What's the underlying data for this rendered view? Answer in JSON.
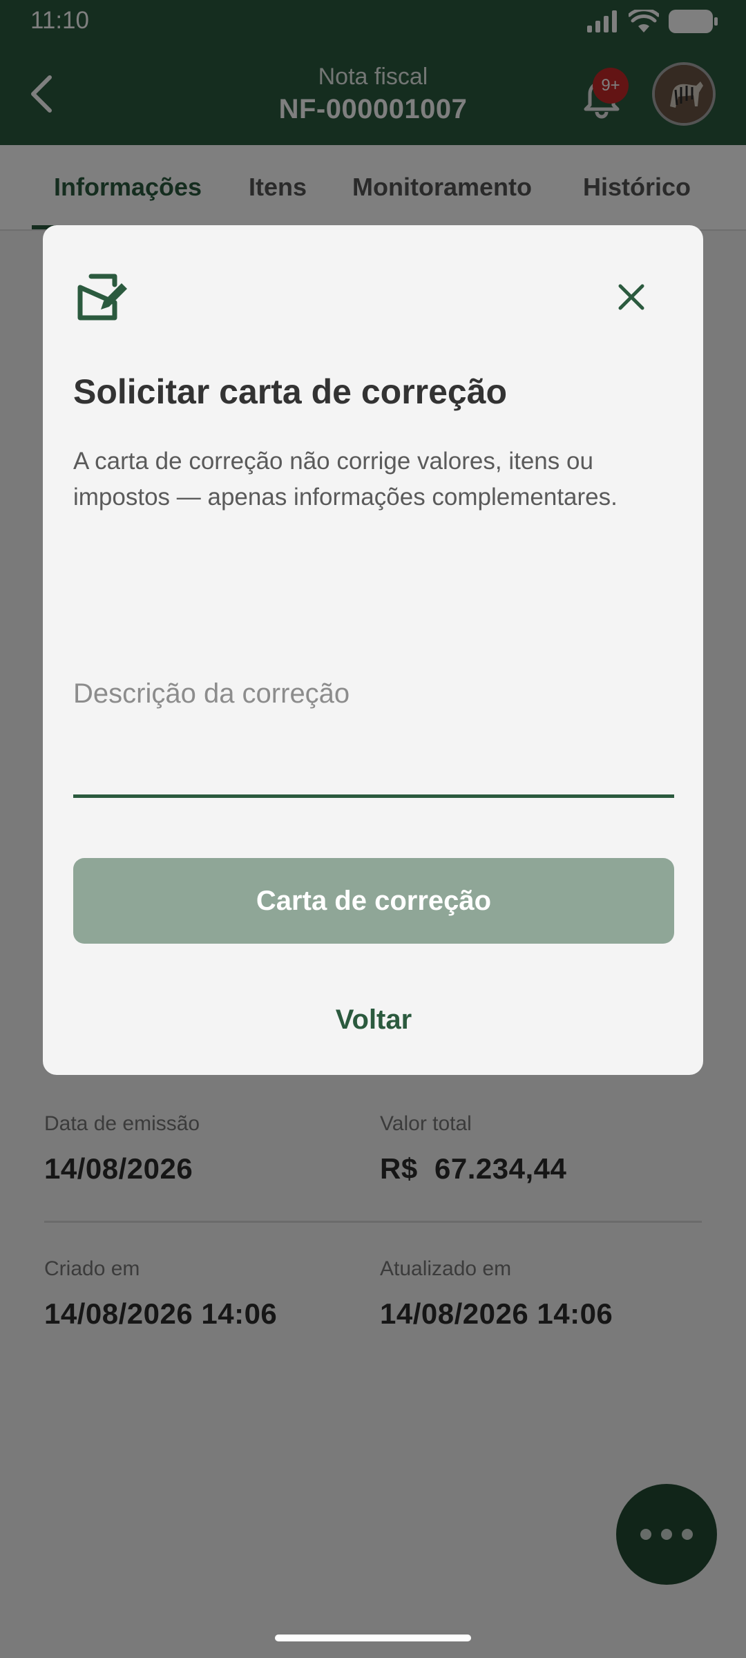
{
  "status_bar": {
    "time": "11:10"
  },
  "header": {
    "subtitle": "Nota fiscal",
    "title": "NF-000001007",
    "notification_badge": "9+"
  },
  "tabs": [
    {
      "label": "Informações",
      "active": true
    },
    {
      "label": "Itens",
      "active": false
    },
    {
      "label": "Monitoramento",
      "active": false
    },
    {
      "label": "Histórico",
      "active": false
    }
  ],
  "details": {
    "issue_date": {
      "label": "Data de emissão",
      "value": "14/08/2026"
    },
    "total_value": {
      "label": "Valor total",
      "value": "R$  67.234,44"
    },
    "created_at": {
      "label": "Criado em",
      "value": "14/08/2026 14:06"
    },
    "updated_at": {
      "label": "Atualizado em",
      "value": "14/08/2026 14:06"
    }
  },
  "dialog": {
    "title": "Solicitar carta de correção",
    "description": "A carta de correção não corrige valores, itens ou impostos — apenas informações complementares.",
    "input_placeholder": "Descrição da correção",
    "primary_button": "Carta de correção",
    "secondary_button": "Voltar"
  },
  "colors": {
    "brand_green": "#2b5a3e",
    "disabled_button": "#8fa697",
    "badge_red": "#c62828"
  },
  "icons": {
    "back": "chevron-left-icon",
    "notifications": "bell-icon",
    "dialog": "document-edit-icon",
    "close": "close-icon",
    "fab": "more-horizontal-icon"
  }
}
